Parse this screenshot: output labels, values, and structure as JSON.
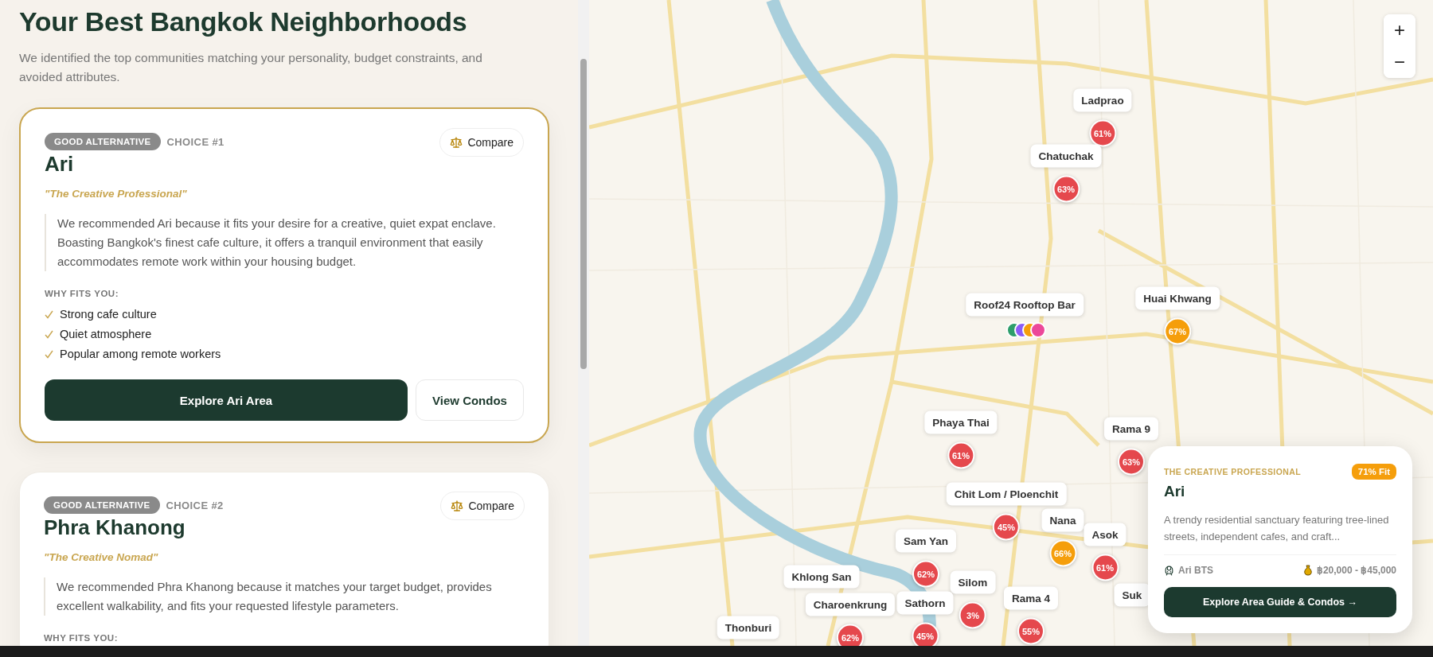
{
  "results": {
    "title": "Your Best Bangkok Neighborhoods",
    "subtitle": "We identified the top communities matching your personality, budget constraints, and avoided attributes.",
    "cards": [
      {
        "badge": "GOOD ALTERNATIVE",
        "choice": "CHOICE #1",
        "selected": true,
        "name": "Ari",
        "persona": "\"The Creative Professional\"",
        "compare": "Compare",
        "reason": "We recommended Ari because it fits your desire for a creative, quiet expat enclave. Boasting Bangkok's finest cafe culture, it offers a tranquil environment that easily accommodates remote work within your housing budget.",
        "why_heading": "WHY FITS YOU:",
        "reasons": [
          "Strong cafe culture",
          "Quiet atmosphere",
          "Popular among remote workers"
        ],
        "primary_button": "Explore Ari Area",
        "secondary_button": "View Condos"
      },
      {
        "badge": "GOOD ALTERNATIVE",
        "choice": "CHOICE #2",
        "selected": false,
        "name": "Phra Khanong",
        "persona": "\"The Creative Nomad\"",
        "compare": "Compare",
        "reason": "We recommended Phra Khanong because it matches your target budget, provides excellent walkability, and fits your requested lifestyle parameters.",
        "why_heading": "WHY FITS YOU:"
      }
    ]
  },
  "map": {
    "zoom_in": "+",
    "zoom_out": "−",
    "markers": [
      {
        "kind": "area",
        "label": "Ladprao",
        "fit": "61%",
        "color": "#e5484d"
      },
      {
        "kind": "area",
        "label": "Chatuchak",
        "fit": "63%",
        "color": "#e5484d"
      },
      {
        "kind": "area",
        "label": "Huai Khwang",
        "fit": "67%",
        "color": "#f59e0b"
      },
      {
        "kind": "place",
        "label": "Roof24 Rooftop Bar"
      },
      {
        "kind": "area",
        "label": "Phaya Thai",
        "fit": "61%",
        "color": "#e5484d"
      },
      {
        "kind": "area",
        "label": "Rama 9",
        "fit": "63%",
        "color": "#e5484d"
      },
      {
        "kind": "area",
        "label": "Chit Lom / Ploenchit",
        "fit": "45%",
        "color": "#e5484d"
      },
      {
        "kind": "area",
        "label": "Nana",
        "fit": "66%",
        "color": "#f59e0b"
      },
      {
        "kind": "area",
        "label": "Sam Yan",
        "fit": "62%",
        "color": "#e5484d"
      },
      {
        "kind": "area",
        "label": "Asok",
        "fit": "61%",
        "color": "#e5484d"
      },
      {
        "kind": "area",
        "label": "Silom",
        "fit": "3%",
        "color": "#e5484d"
      },
      {
        "kind": "area",
        "label": "Sathorn",
        "fit": "45%",
        "color": "#e5484d"
      },
      {
        "kind": "area",
        "label": "Rama 4",
        "fit": "55%",
        "color": "#e5484d"
      },
      {
        "kind": "place",
        "label": "Khlong San"
      },
      {
        "kind": "area",
        "label": "Charoenkrung",
        "fit": "62%",
        "color": "#e5484d"
      },
      {
        "kind": "place",
        "label": "Thonburi"
      },
      {
        "kind": "place",
        "label": "Suk"
      }
    ],
    "popup": {
      "persona": "THE CREATIVE PROFESSIONAL",
      "fit": "71% Fit",
      "name": "Ari",
      "description": "A trendy residential sanctuary featuring tree-lined streets, independent cafes, and craft...",
      "station": "Ari BTS",
      "price": "฿20,000 - ฿45,000",
      "button": "Explore Area Guide & Condos →"
    }
  }
}
